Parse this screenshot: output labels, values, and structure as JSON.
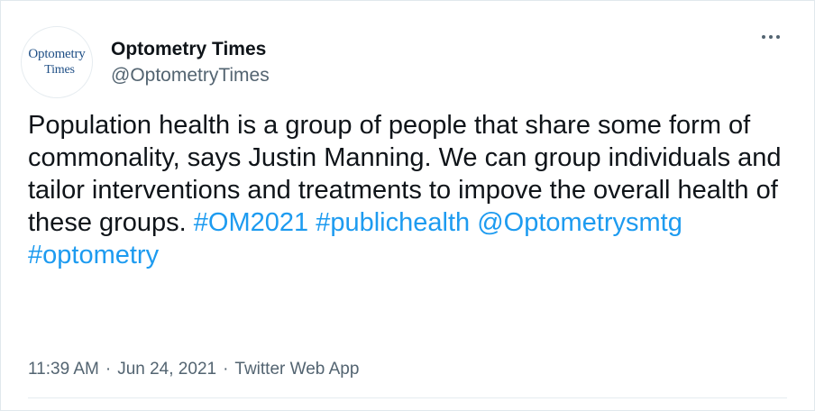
{
  "author": {
    "display_name": "Optometry Times",
    "handle": "@OptometryTimes",
    "avatar_logo_top": "Optometry",
    "avatar_logo_bottom": "Times"
  },
  "more_icon": "more-horizontal-icon",
  "tweet": {
    "text": "Population health is a group of people that share some form of commonality, says Justin Manning. We can group individuals and tailor interventions and treatments to impove the overall health of these groups.",
    "hashtag_1": "#OM2021",
    "hashtag_2": "#publichealth",
    "mention": "@Optometrysmtg",
    "hashtag_3": "#optometry"
  },
  "meta": {
    "time": "11:39 AM",
    "separator": "·",
    "date": "Jun 24, 2021",
    "source": "Twitter Web App"
  },
  "colors": {
    "link": "#1d9bf0",
    "secondary_text": "#536471",
    "primary_text": "#0f1419",
    "logo": "#1f4f86"
  }
}
